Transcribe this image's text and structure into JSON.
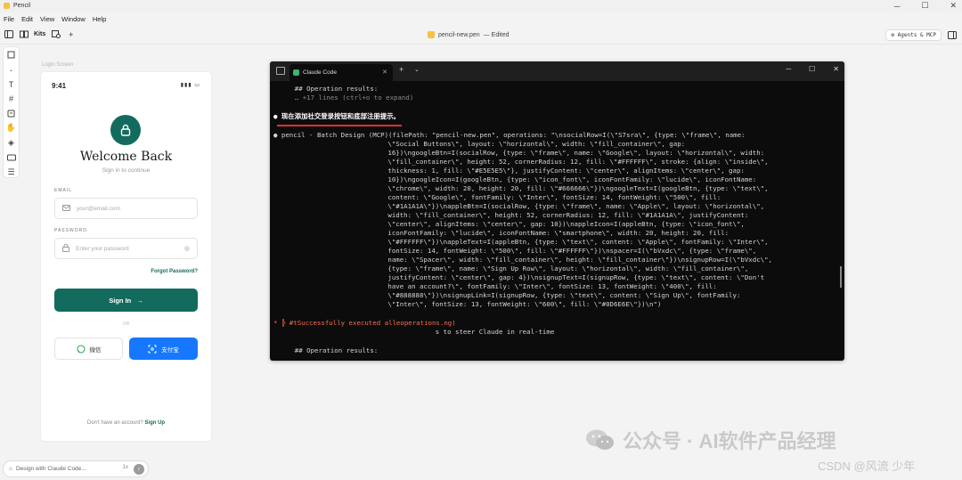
{
  "app": {
    "title": "Pencil"
  },
  "menu": [
    "File",
    "Edit",
    "View",
    "Window",
    "Help"
  ],
  "toolbar": {
    "kits_label": "Kits",
    "file_name": "pencil-new.pen",
    "file_status": "— Edited",
    "agents_label": "Agents & MCP"
  },
  "canvas": {
    "frame_label": "Login Screen",
    "status_time": "9:41",
    "title": "Welcome Back",
    "subtitle": "Sign in to continue",
    "email_label": "EMAIL",
    "email_placeholder": "your@email.com",
    "password_label": "PASSWORD",
    "password_placeholder": "Enter your password",
    "forgot": "Forgot Password?",
    "signin": "Sign In",
    "or": "OR",
    "wechat": "微信",
    "alipay": "支付宝",
    "no_account": "Don't have an account?",
    "signup": "Sign Up"
  },
  "prompt": {
    "placeholder": "Design with Claude Code...",
    "multiplier": "1x"
  },
  "terminal": {
    "tab_title": "Claude Code",
    "lines": [
      "    ## Operation results:",
      "    … +17 lines (ctrl+o to expand)",
      "",
      "● 现在添加社交登录按钮和底部注册提示。",
      "",
      "● pencil - Batch Design (MCP)(filePath: \"pencil-new.pen\", operations: \"\\nsocialRow=I(\\\"S7sra\\\", {type: \\\"frame\\\", name:",
      "                                \\\"Social Buttons\\\", layout: \\\"horizontal\\\", width: \\\"fill_container\\\", gap:",
      "                                16})\\ngoogleBtn=I(socialRow, {type: \\\"frame\\\", name: \\\"Google\\\", layout: \\\"horizontal\\\", width:",
      "                                \\\"fill_container\\\", height: 52, cornerRadius: 12, fill: \\\"#FFFFFF\\\", stroke: {align: \\\"inside\\\",",
      "                                thickness: 1, fill: \\\"#E5E5E5\\\"}, justifyContent: \\\"center\\\", alignItems: \\\"center\\\", gap:",
      "                                10})\\ngoogleIcon=I(googleBtn, {type: \\\"icon_font\\\", iconFontFamily: \\\"lucide\\\", iconFontName:",
      "                                \\\"chrome\\\", width: 20, height: 20, fill: \\\"#666666\\\"})\\ngoogleText=I(googleBtn, {type: \\\"text\\\",",
      "                                content: \\\"Google\\\", fontFamily: \\\"Inter\\\", fontSize: 14, fontWeight: \\\"500\\\", fill:",
      "                                \\\"#1A1A1A\\\"})\\nappleBtn=I(socialRow, {type: \\\"frame\\\", name: \\\"Apple\\\", layout: \\\"horizontal\\\",",
      "                                width: \\\"fill_container\\\", height: 52, cornerRadius: 12, fill: \\\"#1A1A1A\\\", justifyContent:",
      "                                \\\"center\\\", alignItems: \\\"center\\\", gap: 10})\\nappleIcon=I(appleBtn, {type: \\\"icon_font\\\",",
      "                                iconFontFamily: \\\"lucide\\\", iconFontName: \\\"smartphone\\\", width: 20, height: 20, fill:",
      "                                \\\"#FFFFFF\\\"})\\nappleText=I(appleBtn, {type: \\\"text\\\", content: \\\"Apple\\\", fontFamily: \\\"Inter\\\",",
      "                                fontSize: 14, fontWeight: \\\"500\\\", fill: \\\"#FFFFFF\\\"})\\nspacer=I(\\\"bVxdc\\\", {type: \\\"frame\\\",",
      "                                name: \\\"Spacer\\\", width: \\\"fill_container\\\", height: \\\"fill_container\\\"})\\nsignupRow=I(\\\"bVxdc\\\",",
      "                                {type: \\\"frame\\\", name: \\\"Sign Up Row\\\", layout: \\\"horizontal\\\", width: \\\"fill_container\\\",",
      "                                justifyContent: \\\"center\\\", gap: 4})\\nsignupText=I(signupRow, {type: \\\"text\\\", content: \\\"Don't",
      "                                have an account?\\\", fontFamily: \\\"Inter\\\", fontSize: 13, fontWeight: \\\"400\\\", fill:",
      "                                \\\"#888888\\\"})\\nsignupLink=I(signupRow, {type: \\\"text\\\", content: \\\"Sign Up\\\", fontFamily:",
      "                                \\\"Inter\\\", fontSize: 13, fontWeight: \\\"600\\\", fill: \\\"#0D6E6E\\\"})\\n\")",
      "",
      "* ╠ #tSuccessfully executed alleoperations.ng)",
      "                                            s to steer Claude in real-time",
      "",
      "    ## Operation results:"
    ]
  },
  "watermark": {
    "text": "公众号 · AI软件产品经理",
    "csdn": "CSDN @风流 少年"
  },
  "colors": {
    "primary": "#136b5e",
    "alipay": "#1677ff",
    "terminal_bg": "#0c0c0c"
  }
}
